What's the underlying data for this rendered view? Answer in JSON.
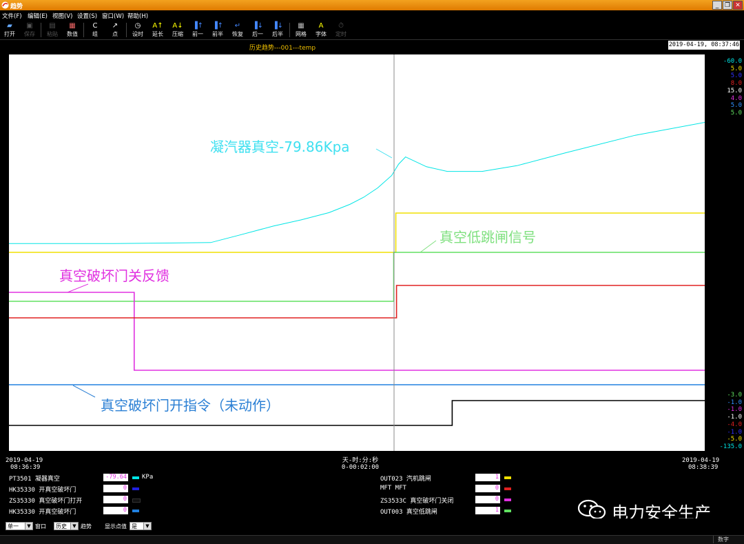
{
  "window": {
    "title": "趋势",
    "buttons": [
      "_",
      "❐",
      "✕"
    ]
  },
  "menu": [
    "文件(F)",
    "编辑(E)",
    "视图(V)",
    "设置(S)",
    "窗口(W)",
    "帮助(H)"
  ],
  "toolbar": [
    {
      "label": "打开",
      "icon": "open-icon",
      "enabled": true
    },
    {
      "label": "保存",
      "icon": "save-icon",
      "enabled": false
    },
    {
      "label": "粘贴",
      "icon": "paste-icon",
      "enabled": false
    },
    {
      "label": "数值",
      "icon": "values-icon",
      "enabled": true
    },
    {
      "label": "组",
      "icon": "group-icon",
      "enabled": true
    },
    {
      "label": "点",
      "icon": "point-icon",
      "enabled": true
    },
    {
      "label": "设时",
      "icon": "set-time-icon",
      "enabled": true
    },
    {
      "label": "延长",
      "icon": "extend-icon",
      "enabled": true
    },
    {
      "label": "压缩",
      "icon": "compress-icon",
      "enabled": true
    },
    {
      "label": "前一",
      "icon": "prev-one-icon",
      "enabled": true
    },
    {
      "label": "前半",
      "icon": "prev-half-icon",
      "enabled": true
    },
    {
      "label": "恢复",
      "icon": "restore-icon",
      "enabled": true
    },
    {
      "label": "后一",
      "icon": "next-one-icon",
      "enabled": true
    },
    {
      "label": "后半",
      "icon": "next-half-icon",
      "enabled": true
    },
    {
      "label": "网格",
      "icon": "grid-icon",
      "enabled": true
    },
    {
      "label": "字体",
      "icon": "font-icon",
      "enabled": true
    },
    {
      "label": "定时",
      "icon": "timer-icon",
      "enabled": false
    }
  ],
  "chart_header": {
    "title": "历史趋势---001---temp",
    "timestamp": "2019-04-19, 08:37:46"
  },
  "scale_top": [
    {
      "text": "-60.0",
      "color": "#00e5e5"
    },
    {
      "text": "5.0",
      "color": "#f0e000"
    },
    {
      "text": "5.0",
      "color": "#3030ff"
    },
    {
      "text": "8.0",
      "color": "#e02020"
    },
    {
      "text": "15.0",
      "color": "#ffffff"
    },
    {
      "text": "4.0",
      "color": "#e030e0"
    },
    {
      "text": "5.0",
      "color": "#3090ff"
    },
    {
      "text": "5.0",
      "color": "#60e060"
    }
  ],
  "scale_bottom": [
    {
      "text": "-3.0",
      "color": "#60e060"
    },
    {
      "text": "-1.0",
      "color": "#3090ff"
    },
    {
      "text": "-1.0",
      "color": "#e030e0"
    },
    {
      "text": "-1.0",
      "color": "#ffffff"
    },
    {
      "text": "-4.0",
      "color": "#e02020"
    },
    {
      "text": "-1.0",
      "color": "#3030ff"
    },
    {
      "text": "-5.0",
      "color": "#f0e000"
    },
    {
      "text": "-135.0",
      "color": "#00e5e5"
    }
  ],
  "annotations": {
    "vacuum": "凝汽器真空-79.86Kpa",
    "trip_signal": "真空低跳闸信号",
    "breaker_close_fb": "真空破坏门关反馈",
    "breaker_open_cmd": "真空破坏门开指令（未动作）"
  },
  "x_axis": {
    "start_date": "2019-04-19",
    "start_time": "08:36:39",
    "mid_label": "天-时:分:秒",
    "mid_value": "0-00:02:00",
    "end_date": "2019-04-19",
    "end_time": "08:38:39"
  },
  "legend_left": [
    {
      "tag": "PT3501 凝器真空",
      "value": "-79.64",
      "value_color": "#e030e0",
      "color": "#00e5e5",
      "unit": "KPa"
    },
    {
      "tag": "HK35330 开真空破坏门",
      "value": "0",
      "value_color": "#e030e0",
      "color": "#2020e0",
      "unit": ""
    },
    {
      "tag": "ZS35330 真空破坏门打开",
      "value": "0",
      "value_color": "#e030e0",
      "color": "#111111",
      "unit": ""
    },
    {
      "tag": "HK35330 开真空破坏门",
      "value": "0",
      "value_color": "#e030e0",
      "color": "#2080e0",
      "unit": ""
    }
  ],
  "legend_right": [
    {
      "tag": "OUT023 汽机跳闸",
      "value": "1",
      "value_color": "#e030e0",
      "color": "#f0e000"
    },
    {
      "tag": "MFT MFT",
      "value": "0",
      "value_color": "#e030e0",
      "color": "#e02020"
    },
    {
      "tag": "ZS3533C 真空破坏门关闭",
      "value": "0",
      "value_color": "#e030e0",
      "color": "#e030e0"
    },
    {
      "tag": "OUT003 真空低跳闸",
      "value": "1",
      "value_color": "#e030e0",
      "color": "#60e060"
    }
  ],
  "bottom": {
    "mode_select": "单一",
    "window_label": "窗口",
    "history_select": "历史",
    "trend_label": "趋势",
    "display_label": "显示点值",
    "display_select": "是"
  },
  "status": {
    "mode": "数字"
  },
  "watermark": "电力安全生产",
  "chart_data": {
    "type": "line",
    "title": "历史趋势---001---temp",
    "x_range": [
      "08:36:39",
      "08:38:39"
    ],
    "cursor_time": "08:37:46",
    "series": [
      {
        "name": "PT3501 凝器真空",
        "color": "#00e5e5",
        "ylim": [
          -135.0,
          -60.0
        ],
        "points": [
          [
            0,
            -95.6
          ],
          [
            0.15,
            -95.6
          ],
          [
            0.29,
            -95.4
          ],
          [
            0.33,
            -94.0
          ],
          [
            0.38,
            -92.2
          ],
          [
            0.42,
            -91.0
          ],
          [
            0.46,
            -89.6
          ],
          [
            0.49,
            -88.0
          ],
          [
            0.51,
            -86.6
          ],
          [
            0.53,
            -84.8
          ],
          [
            0.55,
            -82.4
          ],
          [
            0.56,
            -80.2
          ],
          [
            0.57,
            -78.8
          ],
          [
            0.6,
            -80.7
          ],
          [
            0.63,
            -81.6
          ],
          [
            0.68,
            -81.6
          ],
          [
            0.73,
            -80.5
          ],
          [
            0.8,
            -78.0
          ],
          [
            0.9,
            -74.6
          ],
          [
            1.0,
            -72.1
          ]
        ]
      },
      {
        "name": "OUT023 汽机跳闸",
        "color": "#f0e000",
        "ylim": [
          -5.0,
          5.0
        ],
        "steps": [
          [
            0,
            0
          ],
          [
            0.556,
            0
          ],
          [
            0.556,
            1
          ],
          [
            1.0,
            1
          ]
        ]
      },
      {
        "name": "OUT003 真空低跳闸",
        "color": "#60e060",
        "ylim": [
          -3.0,
          5.0
        ],
        "steps": [
          [
            0,
            0
          ],
          [
            0.553,
            0
          ],
          [
            0.553,
            1
          ],
          [
            1.0,
            1
          ]
        ]
      },
      {
        "name": "ZS3533C 真空破坏门关闭",
        "color": "#e030e0",
        "ylim": [
          -1.0,
          4.0
        ],
        "steps": [
          [
            0,
            1
          ],
          [
            0.18,
            1
          ],
          [
            0.18,
            0
          ],
          [
            1.0,
            0
          ]
        ]
      },
      {
        "name": "MFT MFT",
        "color": "#e02020",
        "ylim": [
          -4.0,
          8.0
        ],
        "steps": [
          [
            0,
            0
          ],
          [
            0.557,
            0
          ],
          [
            0.557,
            1
          ],
          [
            1.0,
            1
          ]
        ]
      },
      {
        "name": "HK35330 开真空破坏门",
        "color": "#2080e0",
        "ylim": [
          -1.0,
          5.0
        ],
        "steps": [
          [
            0,
            0
          ],
          [
            1.0,
            0
          ]
        ]
      },
      {
        "name": "ZS35330 真空破坏门打开",
        "color": "#111111",
        "ylim": [
          -1.0,
          15.0
        ],
        "steps": [
          [
            0,
            0
          ],
          [
            0.637,
            0
          ],
          [
            0.637,
            1
          ],
          [
            1.0,
            1
          ]
        ]
      }
    ]
  }
}
